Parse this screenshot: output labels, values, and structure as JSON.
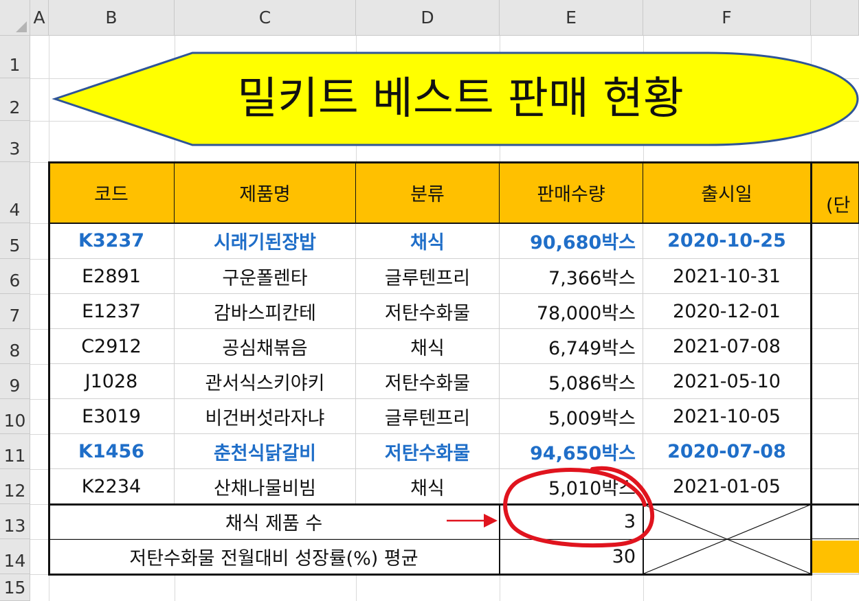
{
  "sheet": {
    "columns": [
      "A",
      "B",
      "C",
      "D",
      "E",
      "F"
    ],
    "rows": [
      "1",
      "2",
      "3",
      "4",
      "5",
      "6",
      "7",
      "8",
      "9",
      "10",
      "11",
      "12",
      "13",
      "14",
      "15"
    ]
  },
  "title": "밀키트 베스트 판매 현황",
  "headers": [
    "코드",
    "제품명",
    "분류",
    "판매수량",
    "출시일"
  ],
  "header_partial": "(단",
  "records": [
    {
      "code": "K3237",
      "name": "시래기된장밥",
      "category": "채식",
      "qty": "90,680박스",
      "date": "2020-10-25",
      "highlight": true
    },
    {
      "code": "E2891",
      "name": "구운폴렌타",
      "category": "글루텐프리",
      "qty": "7,366박스",
      "date": "2021-10-31",
      "highlight": false
    },
    {
      "code": "E1237",
      "name": "감바스피칸테",
      "category": "저탄수화물",
      "qty": "78,000박스",
      "date": "2020-12-01",
      "highlight": false
    },
    {
      "code": "C2912",
      "name": "공심채볶음",
      "category": "채식",
      "qty": "6,749박스",
      "date": "2021-07-08",
      "highlight": false
    },
    {
      "code": "J1028",
      "name": "관서식스키야키",
      "category": "저탄수화물",
      "qty": "5,086박스",
      "date": "2021-05-10",
      "highlight": false
    },
    {
      "code": "E3019",
      "name": "비건버섯라자냐",
      "category": "글루텐프리",
      "qty": "5,009박스",
      "date": "2021-10-05",
      "highlight": false
    },
    {
      "code": "K1456",
      "name": "춘천식닭갈비",
      "category": "저탄수화물",
      "qty": "94,650박스",
      "date": "2020-07-08",
      "highlight": true
    },
    {
      "code": "K2234",
      "name": "산채나물비빔",
      "category": "채식",
      "qty": "5,010박스",
      "date": "2021-01-05",
      "highlight": false
    }
  ],
  "summary": [
    {
      "label": "채식 제품 수",
      "value": "3"
    },
    {
      "label": "저탄수화물 전월대비 성장률(%) 평균",
      "value": "30"
    }
  ],
  "colors": {
    "header_fill": "#ffc000",
    "title_fill": "#ffff00",
    "highlight_text": "#1f6ec8",
    "annotation": "#e0141e"
  }
}
